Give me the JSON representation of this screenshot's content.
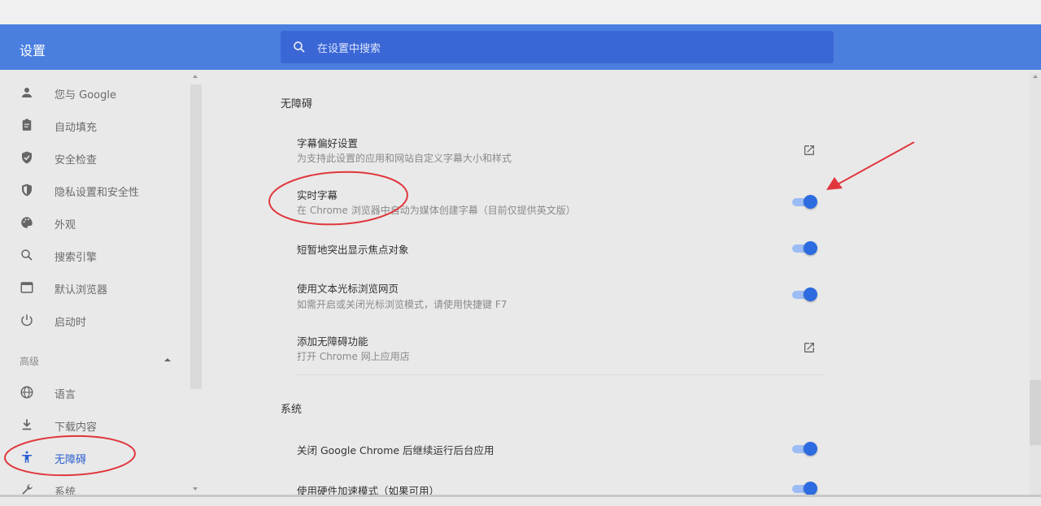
{
  "header": {
    "title": "设置",
    "search_placeholder": "在设置中搜索"
  },
  "sidebar": {
    "items": [
      {
        "label": "您与 Google",
        "icon": "person-icon"
      },
      {
        "label": "自动填充",
        "icon": "clipboard-icon"
      },
      {
        "label": "安全检查",
        "icon": "shield-check-icon"
      },
      {
        "label": "隐私设置和安全性",
        "icon": "privacy-shield-icon"
      },
      {
        "label": "外观",
        "icon": "palette-icon"
      },
      {
        "label": "搜索引擎",
        "icon": "search-icon"
      },
      {
        "label": "默认浏览器",
        "icon": "browser-window-icon"
      },
      {
        "label": "启动时",
        "icon": "power-icon"
      }
    ],
    "advanced_label": "高级",
    "advanced_items": [
      {
        "label": "语言",
        "icon": "globe-icon"
      },
      {
        "label": "下载内容",
        "icon": "download-icon"
      },
      {
        "label": "无障碍",
        "icon": "accessibility-icon",
        "active": true
      },
      {
        "label": "系统",
        "icon": "wrench-icon"
      }
    ]
  },
  "accessibility": {
    "title": "无障碍",
    "rows": [
      {
        "title": "字幕偏好设置",
        "subtitle": "为支持此设置的应用和网站自定义字幕大小和样式",
        "control": "external-link"
      },
      {
        "title": "实时字幕",
        "subtitle": "在 Chrome 浏览器中自动为媒体创建字幕（目前仅提供英文版）",
        "control": "toggle",
        "on": true
      },
      {
        "title": "短暂地突出显示焦点对象",
        "control": "toggle",
        "on": true
      },
      {
        "title": "使用文本光标浏览网页",
        "subtitle": "如需开启或关闭光标浏览模式，请使用快捷键 F7",
        "control": "toggle",
        "on": true
      },
      {
        "title": "添加无障碍功能",
        "subtitle": "打开 Chrome 网上应用店",
        "control": "external-link"
      }
    ]
  },
  "system": {
    "title": "系统",
    "rows": [
      {
        "title": "关闭 Google Chrome 后继续运行后台应用",
        "control": "toggle",
        "on": true
      },
      {
        "title": "使用硬件加速模式（如果可用）",
        "control": "toggle",
        "on": true
      }
    ]
  },
  "colors": {
    "header": "#4a7fe0",
    "search": "#3b67d6",
    "toggle_knob": "#2d6be0",
    "toggle_track": "#9cbcf5",
    "annotation": "#e0373d",
    "active_nav": "#2b5fd0"
  }
}
